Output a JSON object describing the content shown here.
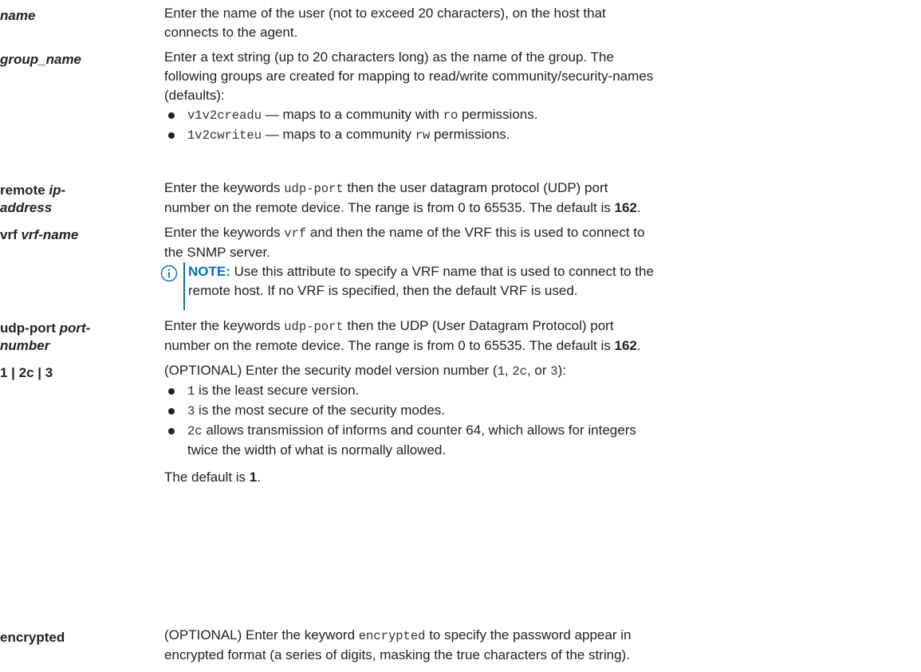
{
  "rows": {
    "name": {
      "term": "name",
      "desc_l1": "Enter the name of the user (not to exceed 20 characters), on the host that",
      "desc_l2": "connects to the agent."
    },
    "group_name": {
      "term": "group_name",
      "desc_l1": "Enter a text string (up to 20 characters long) as the name of the group. The",
      "desc_l2": "following groups are created for mapping to read/write community/security-names",
      "desc_l3": "(defaults):",
      "b1_code": "v1v2creadu",
      "b1_mid": " — maps to a community with ",
      "b1_code2": "ro",
      "b1_end": " permissions.",
      "b2_code": "1v2cwriteu",
      "b2_mid": " — maps to a community ",
      "b2_code2": "rw",
      "b2_end": " permissions."
    },
    "remote": {
      "term_a": "remote ",
      "term_b": "ip-",
      "term_c": "address",
      "l1_a": "Enter the keywords ",
      "l1_code": "udp-port",
      "l1_b": " then the user datagram protocol (UDP) port",
      "l2_a": "number on the remote device. The range is from 0 to 65535. The default is ",
      "l2_bold": "162",
      "l2_end": "."
    },
    "vrf": {
      "term_a": "vrf ",
      "term_b": "vrf-name",
      "l1_a": "Enter the keywords ",
      "l1_code": "vrf",
      "l1_b": " and then the name of the VRF this is used to connect to",
      "l2": "the SNMP server.",
      "note_label": "NOTE:",
      "note_l1": " Use this attribute to specify a VRF name that is used to connect to the",
      "note_l2": "remote host. If no VRF is specified, then the default VRF is used."
    },
    "udp": {
      "term_a": "udp-port ",
      "term_b": "port-",
      "term_c": "number",
      "l1_a": "Enter the keywords ",
      "l1_code": "udp-port",
      "l1_b": " then the UDP (User Datagram Protocol) port",
      "l2_a": "number on the remote device. The range is from 0 to 65535. The default is ",
      "l2_bold": "162",
      "l2_end": "."
    },
    "version": {
      "term": "1 | 2c | 3",
      "l1_a": "(OPTIONAL) Enter the security model version number (",
      "c1": "1",
      "sep1": ", ",
      "c2": "2c",
      "sep2": ", or ",
      "c3": "3",
      "l1_end": "):",
      "b1_code": "1",
      "b1_text": " is the least secure version.",
      "b2_code": "3",
      "b2_text": " is the most secure of the security modes.",
      "b3_code": "2c",
      "b3_text_l1": " allows transmission of informs and counter 64, which allows for integers",
      "b3_text_l2": "twice the width of what is normally allowed.",
      "default_a": "The default is ",
      "default_bold": "1",
      "default_end": "."
    },
    "encrypted": {
      "term": "encrypted",
      "l1_a": "(OPTIONAL) Enter the keyword ",
      "l1_code": "encrypted",
      "l1_b": " to specify the password appear in",
      "l2": "encrypted format (a series of digits, masking the true characters of the string)."
    }
  },
  "colors": {
    "accent": "#0a6cc4",
    "text": "#222222"
  },
  "icons": {
    "note": "info-circle-icon"
  }
}
